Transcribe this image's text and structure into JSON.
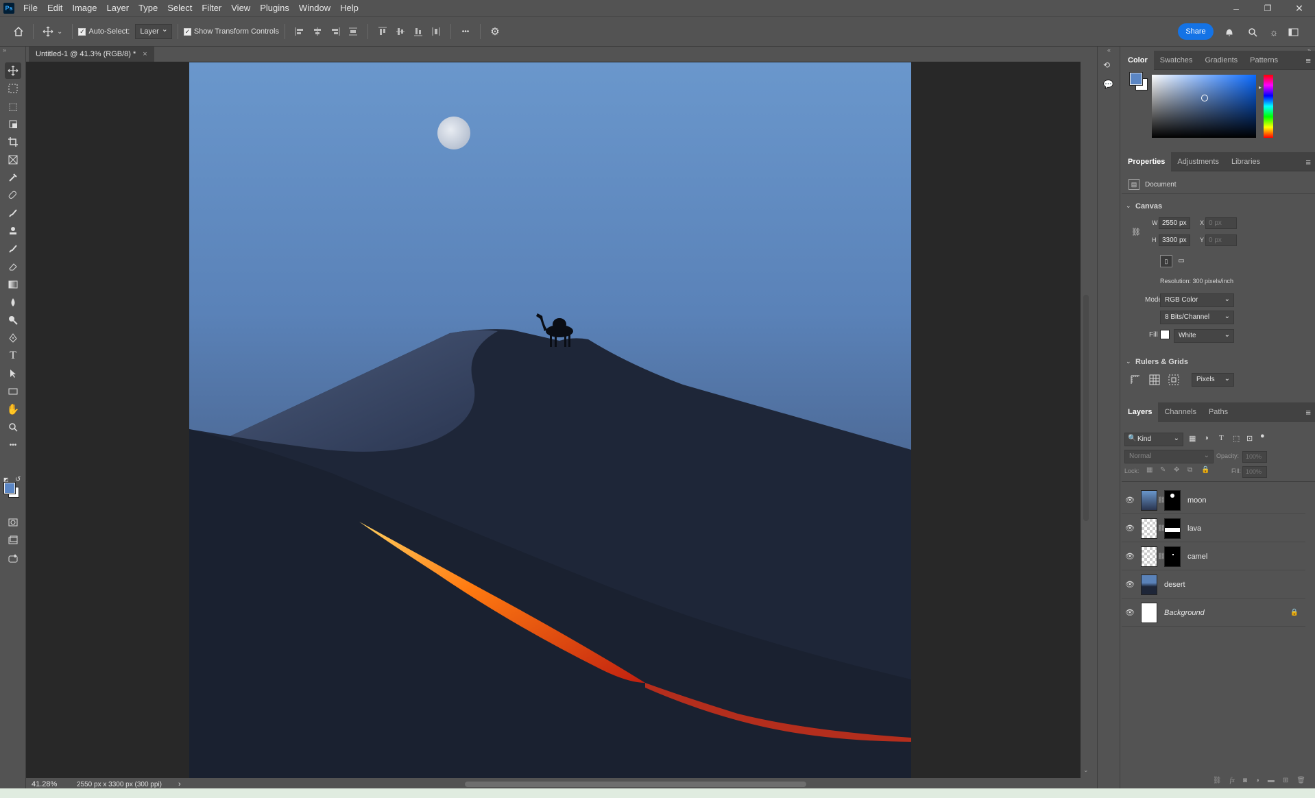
{
  "app": {
    "logo": "Ps"
  },
  "menu": [
    "File",
    "Edit",
    "Image",
    "Layer",
    "Type",
    "Select",
    "Filter",
    "View",
    "Plugins",
    "Window",
    "Help"
  ],
  "window_controls": {
    "minimize": "–",
    "restore": "❐",
    "close": "✕"
  },
  "options": {
    "auto_select_label": "Auto-Select:",
    "auto_select_value": "Layer",
    "transform_label": "Show Transform Controls",
    "more": "•••",
    "share": "Share"
  },
  "document": {
    "tab_title": "Untitled-1 @ 41.3% (RGB/8) *",
    "tab_close": "×"
  },
  "status": {
    "zoom": "41.28%",
    "info": "2550 px x 3300 px (300 ppi)",
    "arrow": "›"
  },
  "color_panel": {
    "tabs": [
      "Color",
      "Swatches",
      "Gradients",
      "Patterns"
    ],
    "foreground": "#5b86c4",
    "background": "#ffffff"
  },
  "properties_panel": {
    "tabs": [
      "Properties",
      "Adjustments",
      "Libraries"
    ],
    "doc_label": "Document",
    "canvas_heading": "Canvas",
    "w_label": "W",
    "w_value": "2550 px",
    "h_label": "H",
    "h_value": "3300 px",
    "x_label": "X",
    "x_value": "0 px",
    "y_label": "Y",
    "y_value": "0 px",
    "resolution": "Resolution: 300 pixels/inch",
    "mode_label": "Mode",
    "mode_value": "RGB Color",
    "bits_value": "8 Bits/Channel",
    "fill_label": "Fill",
    "fill_value": "White",
    "rulers_heading": "Rulers & Grids",
    "units_value": "Pixels"
  },
  "layers_panel": {
    "tabs": [
      "Layers",
      "Channels",
      "Paths"
    ],
    "kind_filter": "Kind",
    "blend_mode": "Normal",
    "opacity_label": "Opacity:",
    "opacity_value": "100%",
    "lock_label": "Lock:",
    "fill_label": "Fill:",
    "fill_value": "100%",
    "layers": [
      {
        "name": "moon",
        "visible": true
      },
      {
        "name": "lava",
        "visible": true
      },
      {
        "name": "camel",
        "visible": true
      },
      {
        "name": "desert",
        "visible": true
      },
      {
        "name": "Background",
        "visible": true,
        "locked": true
      }
    ]
  }
}
